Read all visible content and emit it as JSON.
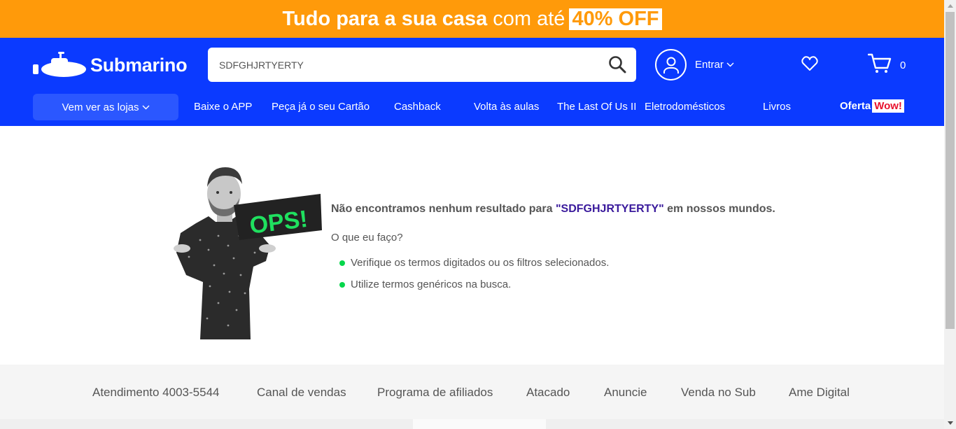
{
  "promo": {
    "headline_bold": "Tudo para a sua casa",
    "headline_light": "com até",
    "discount": "40% OFF"
  },
  "header": {
    "logo_text": "Submarino",
    "search": {
      "value": "SDFGHJRTYERTY",
      "placeholder": ""
    },
    "account_label": "Entrar",
    "cart_count": "0",
    "icons": [
      "submarine-logo-icon",
      "search-icon",
      "user-icon",
      "chevron-down-icon",
      "heart-icon",
      "cart-icon"
    ]
  },
  "nav": {
    "stores_label": "Vem ver as lojas",
    "links": [
      "Baixe o APP",
      "Peça já o seu Cartão",
      "Cashback",
      "Volta às aulas",
      "The Last Of Us II",
      "Eletrodomésticos",
      "Livros"
    ],
    "oferta": "Oferta",
    "wow": "Wow!"
  },
  "main": {
    "image_text": "OPS!",
    "title_before": "Não encontramos nenhum resultado para ",
    "title_term": "\"SDFGHJRTYERTY\"",
    "title_after": " em nossos mundos.",
    "subtitle": "O que eu faço?",
    "tips": [
      "Verifique os termos digitados ou os filtros selecionados.",
      "Utilize termos genéricos na busca."
    ]
  },
  "footer": {
    "links": [
      "Atendimento 4003-5544",
      "Canal de vendas",
      "Programa de afiliados",
      "Atacado",
      "Anuncie",
      "Venda no Sub",
      "Ame Digital"
    ]
  },
  "colors": {
    "promo_orange": "#ff9a0a",
    "brand_blue": "#0b3aff",
    "stores_button_blue": "#2b57ff",
    "bullet_green": "#06d64b",
    "wow_red": "#e8112d",
    "search_term_purple": "#3a1a9c"
  }
}
